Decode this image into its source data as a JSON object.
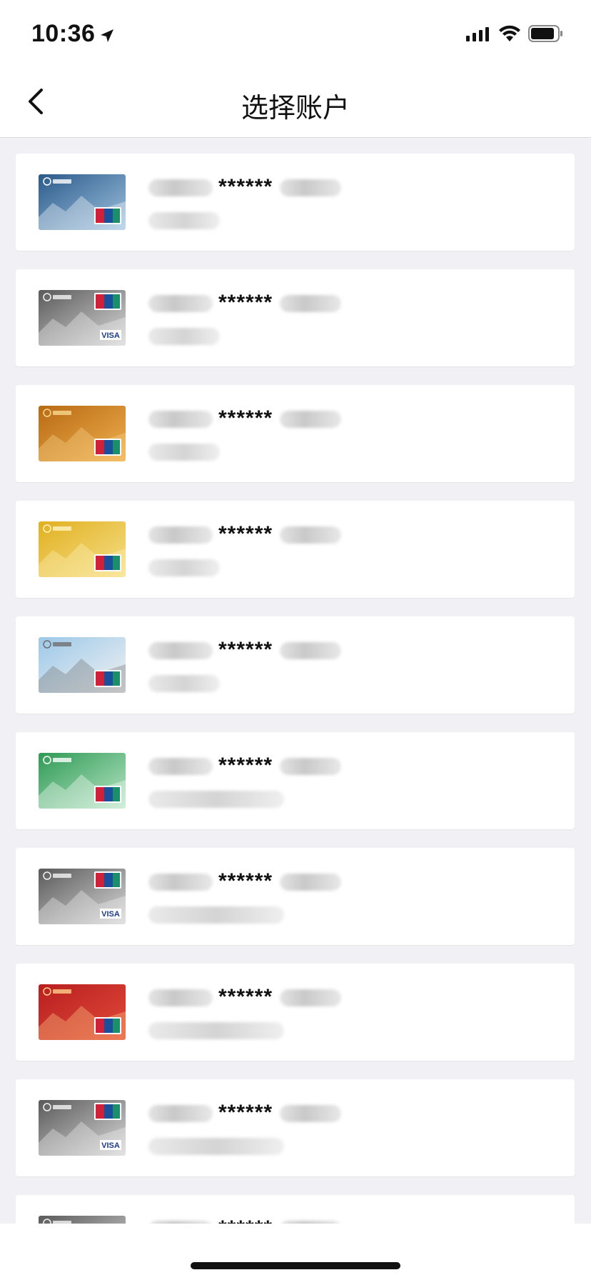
{
  "status_bar": {
    "time": "10:36",
    "icons": [
      "location-arrow-icon",
      "cellular-signal-icon",
      "wifi-icon",
      "battery-icon"
    ]
  },
  "nav": {
    "title": "选择账户",
    "back_icon": "chevron-left-icon"
  },
  "accounts": [
    {
      "masked": "******",
      "card_style": "blue-mountain",
      "network": "UnionPay",
      "name_width": "short"
    },
    {
      "masked": "******",
      "card_style": "silver-greatwall",
      "network": "VISA",
      "name_width": "short"
    },
    {
      "masked": "******",
      "card_style": "gold-orange",
      "network": "UnionPay",
      "name_width": "short"
    },
    {
      "masked": "******",
      "card_style": "yellow-gold",
      "network": "UnionPay",
      "name_width": "short"
    },
    {
      "masked": "******",
      "card_style": "greatwall-color",
      "network": "UnionPay",
      "name_width": "short"
    },
    {
      "masked": "******",
      "card_style": "green",
      "network": "UnionPay",
      "name_width": "wide"
    },
    {
      "masked": "******",
      "card_style": "silver-greatwall",
      "network": "VISA",
      "name_width": "wide"
    },
    {
      "masked": "******",
      "card_style": "red-zodiac",
      "network": "UnionPay",
      "name_width": "wide"
    },
    {
      "masked": "******",
      "card_style": "silver-greatwall",
      "network": "VISA",
      "name_width": "wide"
    },
    {
      "masked": "******",
      "card_style": "silver-greatwall",
      "network": "UnionPay",
      "name_width": "wide"
    }
  ],
  "colors": {
    "background": "#f0f0f5",
    "surface": "#ffffff",
    "text": "#111111"
  }
}
